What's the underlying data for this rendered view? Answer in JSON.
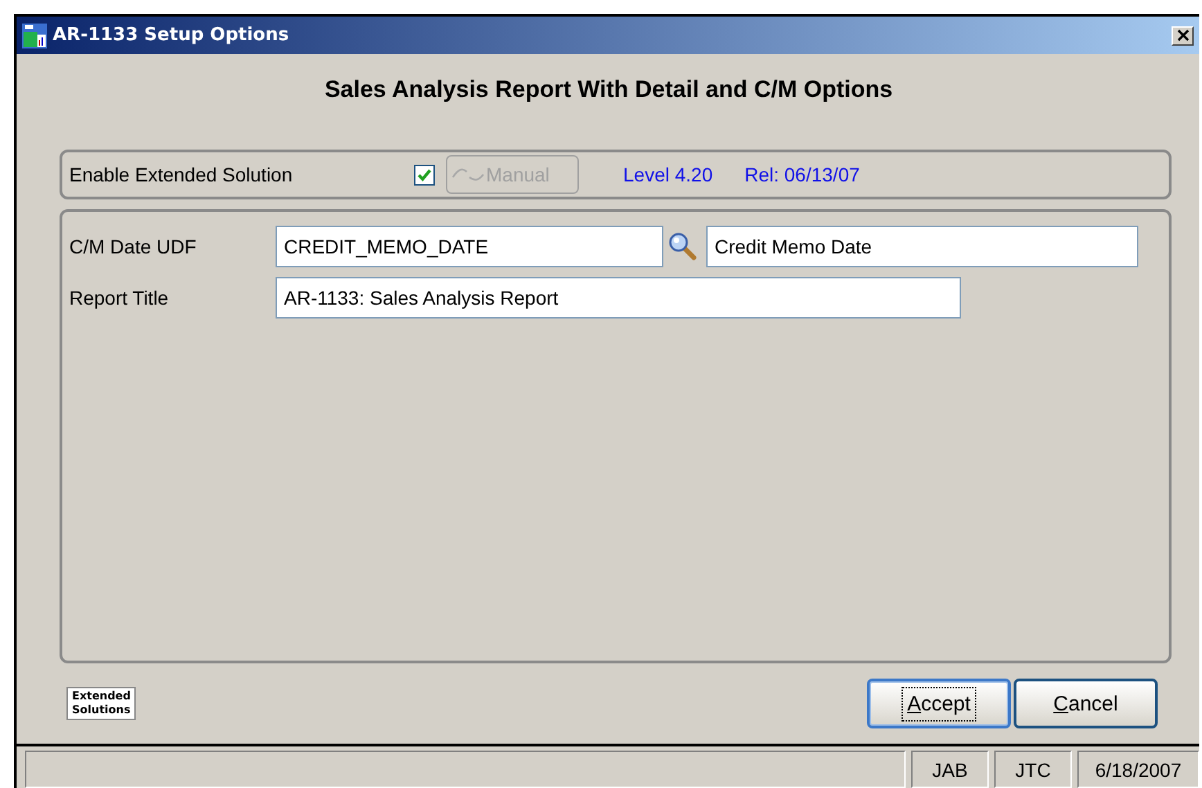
{
  "window": {
    "title": "AR-1133 Setup Options"
  },
  "heading": "Sales Analysis Report With Detail and C/M Options",
  "enable_group": {
    "label": "Enable Extended Solution",
    "checked": true,
    "manual_button": {
      "label": "Manual",
      "disabled": true
    },
    "level": "Level 4.20",
    "release": "Rel: 06/13/07"
  },
  "fields": [
    {
      "label": "C/M Date UDF",
      "value": "CREDIT_MEMO_DATE",
      "lookup": true,
      "description": "Credit Memo Date"
    },
    {
      "label": "Report Title",
      "value": "AR-1133: Sales Analysis Report",
      "lookup": false
    }
  ],
  "logo": [
    "Extended",
    "Solutions"
  ],
  "buttons": [
    {
      "label": "Accept",
      "default": true
    },
    {
      "label": "Cancel",
      "default": false
    }
  ],
  "status_bar": [
    "JAB",
    "JTC",
    "6/18/2007"
  ]
}
